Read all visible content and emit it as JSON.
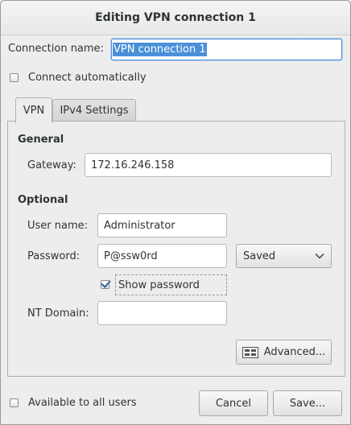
{
  "window": {
    "title": "Editing VPN connection 1"
  },
  "connection_name": {
    "label": "Connection name:",
    "value": "VPN connection 1"
  },
  "connect_automatically": {
    "label": "Connect automatically",
    "checked": false
  },
  "tabs": [
    {
      "label": "VPN",
      "active": true
    },
    {
      "label": "IPv4 Settings",
      "active": false
    }
  ],
  "general": {
    "title": "General",
    "gateway_label": "Gateway:",
    "gateway_value": "172.16.246.158"
  },
  "optional": {
    "title": "Optional",
    "username_label": "User name:",
    "username_value": "Administrator",
    "password_label": "Password:",
    "password_value": "P@ssw0rd",
    "password_storage": "Saved",
    "show_password_label": "Show password",
    "show_password_checked": true,
    "nt_domain_label": "NT Domain:",
    "nt_domain_value": ""
  },
  "advanced_button": "Advanced...",
  "available_all_users": {
    "label": "Available to all users",
    "checked": false
  },
  "buttons": {
    "cancel": "Cancel",
    "save": "Save..."
  },
  "colors": {
    "selection": "#4a90d9",
    "check": "#3465a4"
  },
  "icons": {
    "dropdown": "chevron-down-icon",
    "advanced": "settings-grid-icon"
  }
}
